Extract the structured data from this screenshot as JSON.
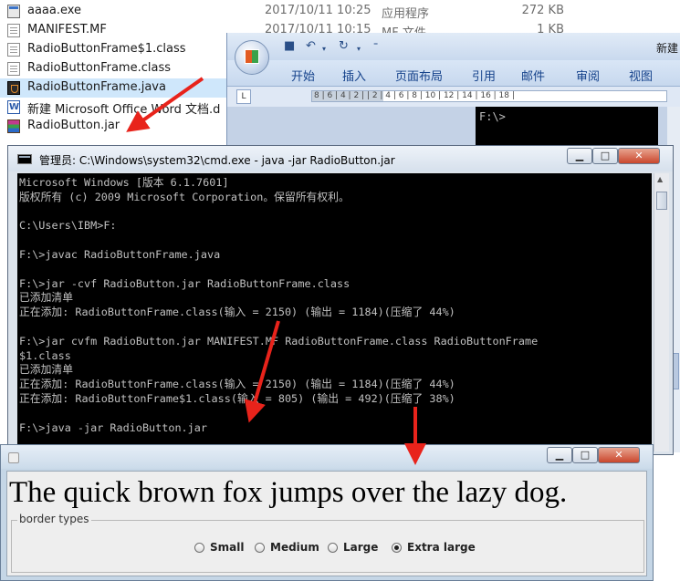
{
  "explorer": {
    "files": [
      {
        "name": "aaaa.exe",
        "date": "2017/10/11 10:25",
        "type": "应用程序",
        "size": "272 KB",
        "icon": "exe-icon"
      },
      {
        "name": "MANIFEST.MF",
        "date": "2017/10/11 10:15",
        "type": "MF 文件",
        "size": "1 KB",
        "icon": "document-icon"
      },
      {
        "name": "RadioButtonFrame$1.class",
        "date": "",
        "type": "",
        "size": "",
        "icon": "document-icon"
      },
      {
        "name": "RadioButtonFrame.class",
        "date": "",
        "type": "",
        "size": "",
        "icon": "document-icon"
      },
      {
        "name": "RadioButtonFrame.java",
        "date": "",
        "type": "",
        "size": "",
        "icon": "java-file-icon"
      },
      {
        "name": "新建 Microsoft Office Word 文档.d",
        "date": "",
        "type": "",
        "size": "",
        "icon": "word-doc-icon"
      },
      {
        "name": "RadioButton.jar",
        "date": "",
        "type": "",
        "size": "",
        "icon": "jar-archive-icon"
      }
    ]
  },
  "word": {
    "title": "新建",
    "tabs": [
      "开始",
      "插入",
      "页面布局",
      "引用",
      "邮件",
      "审阅",
      "视图"
    ],
    "ruler_text": "8 | 6 | 4 | 2 |     | 2 | 4 | 6 | 8 | 10 | 12 | 14 | 16 | 18 |",
    "doc_text": "F:\\>"
  },
  "cmd": {
    "title": "管理员: C:\\Windows\\system32\\cmd.exe - java  -jar RadioButton.jar",
    "console_lines": [
      "Microsoft Windows [版本 6.1.7601]",
      "版权所有 (c) 2009 Microsoft Corporation。保留所有权利。",
      "",
      "C:\\Users\\IBM>F:",
      "",
      "F:\\>javac RadioButtonFrame.java",
      "",
      "F:\\>jar -cvf RadioButton.jar RadioButtonFrame.class",
      "已添加清单",
      "正在添加: RadioButtonFrame.class(输入 = 2150) (输出 = 1184)(压缩了 44%)",
      "",
      "F:\\>jar cvfm RadioButton.jar MANIFEST.MF RadioButtonFrame.class RadioButtonFrame",
      "$1.class",
      "已添加清单",
      "正在添加: RadioButtonFrame.class(输入 = 2150) (输出 = 1184)(压缩了 44%)",
      "正在添加: RadioButtonFrame$1.class(输入 = 805) (输出 = 492)(压缩了 38%)",
      "",
      "F:\\>java -jar RadioButton.jar"
    ]
  },
  "java_frame": {
    "sample_text": "The quick brown fox jumps over the lazy dog.",
    "group_title": "border types",
    "options": [
      {
        "label": "Small",
        "checked": false
      },
      {
        "label": "Medium",
        "checked": false
      },
      {
        "label": "Large",
        "checked": false
      },
      {
        "label": "Extra large",
        "checked": true
      }
    ]
  },
  "window_buttons": {
    "minimize": "▁",
    "maximize": "□",
    "close": "✕"
  },
  "colors": {
    "console_bg": "#000000",
    "console_fg": "#c0c0c0",
    "arrow": "#e8231b",
    "selection": "#cfe7fb"
  }
}
